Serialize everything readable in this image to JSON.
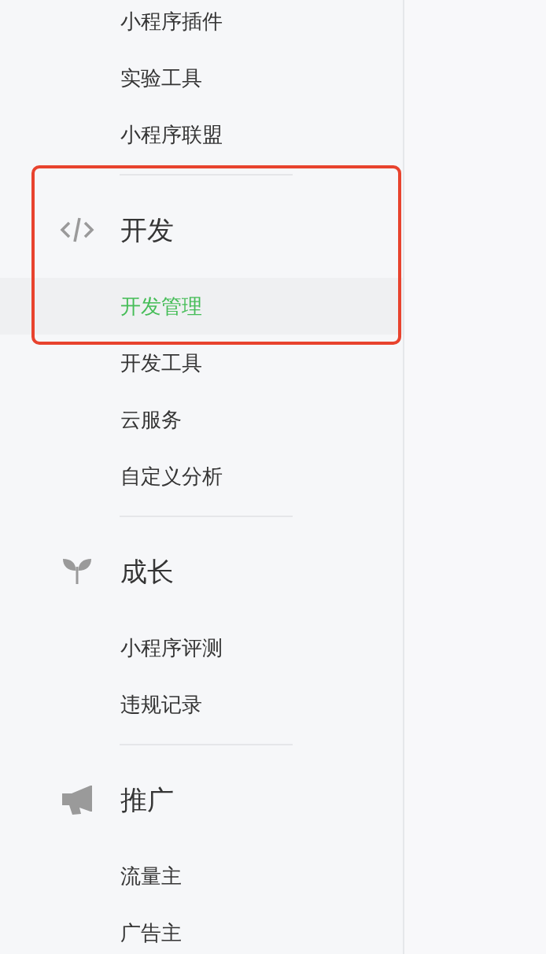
{
  "nav": {
    "items": [
      {
        "label": "小程序插件",
        "selected": false
      },
      {
        "label": "实验工具",
        "selected": false
      },
      {
        "label": "小程序联盟",
        "selected": false
      }
    ],
    "groups": [
      {
        "title": "开发",
        "highlighted": true,
        "items": [
          {
            "label": "开发管理",
            "selected": true
          },
          {
            "label": "开发工具",
            "selected": false
          },
          {
            "label": "云服务",
            "selected": false
          },
          {
            "label": "自定义分析",
            "selected": false
          }
        ]
      },
      {
        "title": "成长",
        "highlighted": false,
        "items": [
          {
            "label": "小程序评测",
            "selected": false
          },
          {
            "label": "违规记录",
            "selected": false
          }
        ]
      },
      {
        "title": "推广",
        "highlighted": false,
        "items": [
          {
            "label": "流量主",
            "selected": false
          },
          {
            "label": "广告主",
            "selected": false
          }
        ]
      }
    ]
  }
}
